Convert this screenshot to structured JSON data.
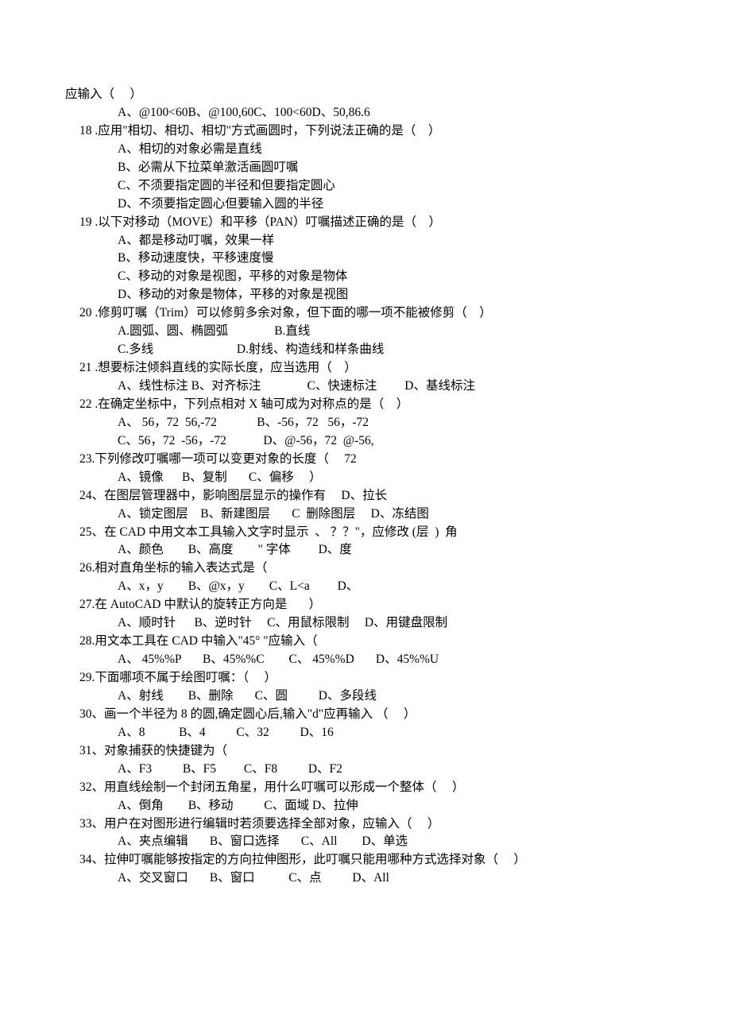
{
  "lines": [
    {
      "cls": "indent0",
      "text": "应输入（     ）"
    },
    {
      "cls": "indent3",
      "text": "A、@100<60B、@100,60C、100<60D、50,86.6"
    },
    {
      "cls": "indent1",
      "text": "18 .应用\"相切、相切、相切\"方式画圆时，下列说法正确的是（    ）"
    },
    {
      "cls": "indent3",
      "text": "A、相切的对象必需是直线"
    },
    {
      "cls": "indent3",
      "text": "B、必需从下拉菜单激活画圆叮嘱"
    },
    {
      "cls": "indent3",
      "text": "C、不须要指定圆的半径和但要指定圆心"
    },
    {
      "cls": "indent3",
      "text": "D、不须要指定圆心但要输入圆的半径"
    },
    {
      "cls": "indent1",
      "text": "19 .以下对移动（MOVE）和平移（PAN）叮嘱描述正确的是（    ）"
    },
    {
      "cls": "indent3",
      "text": "A、都是移动叮嘱，效果一样"
    },
    {
      "cls": "indent3",
      "text": "B、移动速度快，平移速度慢"
    },
    {
      "cls": "indent3",
      "text": "C、移动的对象是视图，平移的对象是物体"
    },
    {
      "cls": "indent3",
      "text": "D、移动的对象是物体，平移的对象是视图"
    },
    {
      "cls": "indent1",
      "text": "20 .修剪叮嘱（Trim）可以修剪多余对象，但下面的哪一项不能被修剪（    ）"
    },
    {
      "cls": "indent3",
      "text": "A.圆弧、圆、椭圆弧               B.直线"
    },
    {
      "cls": "indent3",
      "text": "C.多线                           D.射线、构造线和样条曲线"
    },
    {
      "cls": "indent1",
      "text": "21 .想要标注倾斜直线的实际长度，应当选用（    ）"
    },
    {
      "cls": "indent3",
      "text": "A、线性标注 B、对齐标注               C、快速标注         D、基线标注"
    },
    {
      "cls": "indent1",
      "text": "22 .在确定坐标中，下列点相对 X 轴可成为对称点的是（    ）"
    },
    {
      "cls": "indent3",
      "text": "A、 56，72  56,-72             B、-56，72   56，-72"
    },
    {
      "cls": "indent3",
      "text": "C、56，72  -56，-72            D、@-56，72  @-56,"
    },
    {
      "cls": "indent1",
      "text": "23.下列修改叮嘱哪一项可以变更对象的长度（     72"
    },
    {
      "cls": "indent3",
      "text": "A、镜像      B、复制       C、偏移     ）"
    },
    {
      "cls": "indent1",
      "text": "24、在图层管理器中，影响图层显示的操作有     D、拉长"
    },
    {
      "cls": "indent3",
      "text": "A、锁定图层    B、新建图层       C  删除图层     D、冻结图"
    },
    {
      "cls": "indent1",
      "text": "25、在 CAD 中用文本工具输入文字时显示  、 ？？\"，应修改 (层  )  角"
    },
    {
      "cls": "indent3",
      "text": "A、颜色        B、高度        \" 字体         D、度"
    },
    {
      "cls": "indent1",
      "text": "26.相对直角坐标的输入表达式是（"
    },
    {
      "cls": "indent3",
      "text": "A、x，y        B、@x，y        C、L<a         D、"
    },
    {
      "cls": "indent1",
      "text": "27.在 AutoCAD 中默认的旋转正方向是       ）"
    },
    {
      "cls": "indent3",
      "text": "A、顺时针      B、逆时针     C、用鼠标限制     D、用键盘限制"
    },
    {
      "cls": "indent1",
      "text": "28.用文本工具在 CAD 中输入\"45° \"应输入（"
    },
    {
      "cls": "indent3",
      "text": "A、 45%%P       B、45%%C        C、 45%%D       D、45%%U"
    },
    {
      "cls": "indent1",
      "text": "29.下面哪项不属于绘图叮嘱：（     ）"
    },
    {
      "cls": "indent3",
      "text": "A、射线        B、删除       C、圆          D、多段线"
    },
    {
      "cls": "indent1",
      "text": "30、画一个半径为 8 的圆,确定圆心后,输入\"d\"应再输入 （     ）"
    },
    {
      "cls": "indent3",
      "text": "A、8           B、4          C、32          D、16"
    },
    {
      "cls": "indent1",
      "text": "31、对象捕获的快捷键为（"
    },
    {
      "cls": "indent3",
      "text": "A、F3          B、F5         C、F8          D、F2"
    },
    {
      "cls": "indent1",
      "text": "32、用直线绘制一个封闭五角星，用什么叮嘱可以形成一个整体（     ）"
    },
    {
      "cls": "indent3",
      "text": "A、倒角        B、移动          C、面域 D、拉伸"
    },
    {
      "cls": "indent1",
      "text": "33、用户在对图形进行编辑时若须要选择全部对象，应输入（     ）"
    },
    {
      "cls": "indent3",
      "text": "A、夹点编辑       B、窗口选择       C、All        D、单选"
    },
    {
      "cls": "indent1",
      "text": "34、拉伸叮嘱能够按指定的方向拉伸图形，此叮嘱只能用哪种方式选择对象（     ）"
    },
    {
      "cls": "indent3",
      "text": "A、交叉窗口       B、窗口           C、点          D、All"
    }
  ]
}
